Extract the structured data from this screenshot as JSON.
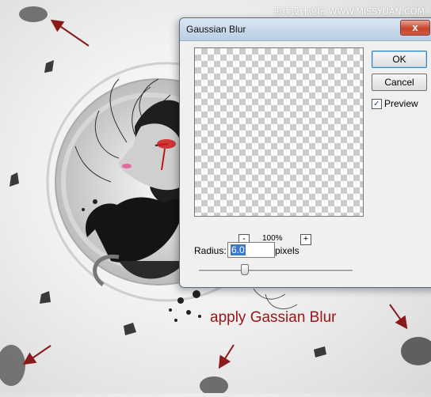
{
  "watermark": "思缘设计论坛 WWW.MISSYUAN.COM",
  "caption": "apply Gassian Blur",
  "dialog": {
    "title": "Gaussian Blur",
    "ok_label": "OK",
    "cancel_label": "Cancel",
    "preview_label": "Preview",
    "preview_checked": "✓",
    "zoom_out": "-",
    "zoom_in": "+",
    "zoom_level": "100%",
    "radius_label": "Radius:",
    "radius_value": "6.0",
    "radius_unit": "pixels",
    "close_glyph": "x"
  },
  "colors": {
    "caption": "#9b1414",
    "arrow": "#8b1a1a"
  }
}
